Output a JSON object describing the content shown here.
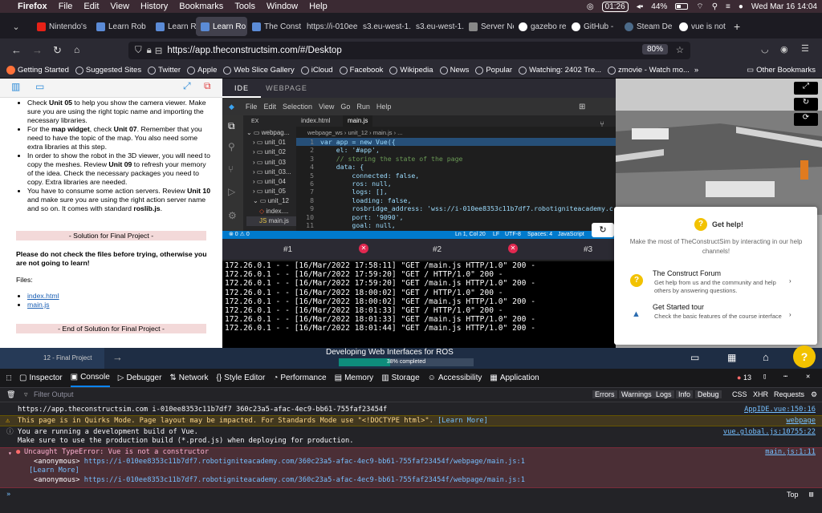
{
  "menubar": {
    "app": "Firefox",
    "items": [
      "File",
      "Edit",
      "View",
      "History",
      "Bookmarks",
      "Tools",
      "Window",
      "Help"
    ],
    "timer": "01:26",
    "battery": "44%",
    "datetime": "Wed Mar 16  14:04"
  },
  "tabs": [
    {
      "label": "Nintendo's",
      "color": "#e62117"
    },
    {
      "label": "Learn Rob",
      "color": "#5b8bd6"
    },
    {
      "label": "Learn Rob",
      "color": "#5b8bd6"
    },
    {
      "label": "Learn Ro",
      "color": "#5b8bd6",
      "active": true
    },
    {
      "label": "The Const",
      "color": "#5b8bd6"
    },
    {
      "label": "https://i-010ee",
      "color": ""
    },
    {
      "label": "s3.eu-west-1.",
      "color": ""
    },
    {
      "label": "s3.eu-west-1.",
      "color": ""
    },
    {
      "label": "Server Nc",
      "color": "#888"
    },
    {
      "label": "gazebo re",
      "color": "#4285f4"
    },
    {
      "label": "GitHub - ",
      "color": "#fff"
    },
    {
      "label": "Steam De",
      "color": "#1b2838"
    },
    {
      "label": "vue is not",
      "color": "#4285f4"
    }
  ],
  "urlbar": {
    "url": "https://app.theconstructsim.com/#/Desktop",
    "zoom": "80%"
  },
  "bookmarks": [
    "Getting Started",
    "Suggested Sites",
    "Twitter",
    "Apple",
    "Web Slice Gallery",
    "iCloud",
    "Facebook",
    "Wikipedia",
    "News",
    "Popular",
    "Watching: 2402 Tre...",
    "zmovie - Watch mo..."
  ],
  "other_bookmarks": "Other Bookmarks",
  "notebook": {
    "bullets": [
      {
        "pre": "Check ",
        "b": "Unit 05",
        "post": " to help you show the camera viewer. Make sure you are using the right topic name and importing the necessary libraries."
      },
      {
        "pre": "For the ",
        "b": "map widget",
        "post": ", check ",
        "b2": "Unit 07",
        "post2": ". Remember that you need to have the topic of the map. You also need some extra libraries at this step."
      },
      {
        "pre": "In order to show the robot in the 3D viewer, you will need to copy the meshes. Review ",
        "b": "Unit 09",
        "post": " to refresh your memory of the idea. Check the necessary packages you need to copy. Extra libraries are needed."
      },
      {
        "pre": "You have to consume some action servers. Review ",
        "b": "Unit 10",
        "post": " and make sure you are using the right action server name and so on. It comes with standard ",
        "b2": "roslib.js",
        "post2": "."
      }
    ],
    "solution_banner": "- Solution for Final Project -",
    "warning": "Please do not check the files before trying, otherwise you are not going to learn!",
    "files_label": "Files:",
    "files": [
      "index.html",
      "main.js"
    ],
    "end_banner": "- End of Solution for Final Project -"
  },
  "ide": {
    "tabs": [
      "IDE",
      "WEBPAGE"
    ],
    "menu": [
      "File",
      "Edit",
      "Selection",
      "View",
      "Go",
      "Run",
      "Help"
    ],
    "explorer_label": "EX",
    "tree": [
      "webpag...",
      "unit_01",
      "unit_02",
      "unit_03",
      "unit_03...",
      "unit_04",
      "unit_05",
      "unit_12",
      "index....",
      "main.js"
    ],
    "editor_tabs": [
      "index.html",
      "main.js"
    ],
    "breadcrumb": [
      "webpage_ws",
      "unit_12",
      "main.js",
      "..."
    ],
    "lines": [
      {
        "n": "1",
        "t": "var app = new Vue({"
      },
      {
        "n": "2",
        "t": "    el: '#app',"
      },
      {
        "n": "3",
        "t": "    // storing the state of the page"
      },
      {
        "n": "4",
        "t": "    data: {"
      },
      {
        "n": "5",
        "t": "        connected: false,"
      },
      {
        "n": "6",
        "t": "        ros: null,"
      },
      {
        "n": "7",
        "t": "        logs: [],"
      },
      {
        "n": "8",
        "t": "        loading: false,"
      },
      {
        "n": "9",
        "t": "        rosbridge_address: 'wss://i-010ee8353c11b7df7.robotigniteacademy.c"
      },
      {
        "n": "10",
        "t": "        port: '9090',"
      },
      {
        "n": "11",
        "t": "        goal: null,"
      }
    ],
    "status_left": "⊗ 0 ⚠ 0",
    "status_right": [
      "Ln 1, Col 20",
      "LF",
      "UTF-8",
      "Spaces: 4",
      "JavaScript"
    ],
    "terminal_tabs": [
      "#1",
      "#2",
      "#3"
    ],
    "terminal": [
      "172.26.0.1 - - [16/Mar/2022 17:58:11] \"GET /main.js HTTP/1.0\" 200 -",
      "172.26.0.1 - - [16/Mar/2022 17:59:20] \"GET / HTTP/1.0\" 200 -",
      "172.26.0.1 - - [16/Mar/2022 17:59:20] \"GET /main.js HTTP/1.0\" 200 -",
      "172.26.0.1 - - [16/Mar/2022 18:00:02] \"GET / HTTP/1.0\" 200 -",
      "172.26.0.1 - - [16/Mar/2022 18:00:02] \"GET /main.js HTTP/1.0\" 200 -",
      "172.26.0.1 - - [16/Mar/2022 18:01:33] \"GET / HTTP/1.0\" 200 -",
      "172.26.0.1 - - [16/Mar/2022 18:01:33] \"GET /main.js HTTP/1.0\" 200 -",
      "172.26.0.1 - - [16/Mar/2022 18:01:44] \"GET /main.js HTTP/1.0\" 200 -"
    ]
  },
  "help": {
    "title": "Get help!",
    "subtitle": "Make the most of TheConstructSim by interacting in our help channels!",
    "items": [
      {
        "title": "The Construct Forum",
        "desc": "Get help from us and the community and help others by answering questions."
      },
      {
        "title": "Get Started tour",
        "desc": "Check the basic features of the course interface"
      }
    ]
  },
  "course": {
    "prev_label": "12 - Final Project",
    "title": "Developing Web Interfaces for ROS",
    "progress_text": "38% completed",
    "progress": 0.38,
    "help_icon": "?"
  },
  "devtools": {
    "tabs": [
      "Inspector",
      "Console",
      "Debugger",
      "Network",
      "Style Editor",
      "Performance",
      "Memory",
      "Storage",
      "Accessibility",
      "Application"
    ],
    "error_count": "13",
    "filter_placeholder": "Filter Output",
    "levels": [
      "Errors",
      "Warnings",
      "Logs",
      "Info",
      "Debug"
    ],
    "extra": [
      "CSS",
      "XHR",
      "Requests"
    ],
    "messages": [
      {
        "text": "https://app.theconstructsim.com i-010ee8353c11b7df7 360c23a5-afac-4ec9-bb61-755faf23454f",
        "src": "AppIDE.vue:150:16",
        "kind": "log"
      },
      {
        "text": "This page is in Quirks Mode. Page layout may be impacted. For Standards Mode use \"<!DOCTYPE html>\".",
        "more": "[Learn More]",
        "src": "webpage",
        "kind": "warn"
      },
      {
        "text": "You are running a development build of Vue.",
        "text2": "Make sure to use the production build (*.prod.js) when deploying for production.",
        "src": "vue.global.js:10755:22",
        "kind": "info"
      },
      {
        "text": "Uncaught TypeError: Vue is not a constructor",
        "anon1": "<anonymous>",
        "url1": "https://i-010ee8353c11b7df7.robotigniteacademy.com/360c23a5-afac-4ec9-bb61-755faf23454f/webpage/main.js:1",
        "more": "[Learn More]",
        "anon2": "<anonymous>",
        "url2": "https://i-010ee8353c11b7df7.robotigniteacademy.com/360c23a5-afac-4ec9-bb61-755faf23454f/webpage/main.js:1",
        "src": "main.js:1:11",
        "kind": "error"
      }
    ],
    "bottom_right": "Top"
  }
}
